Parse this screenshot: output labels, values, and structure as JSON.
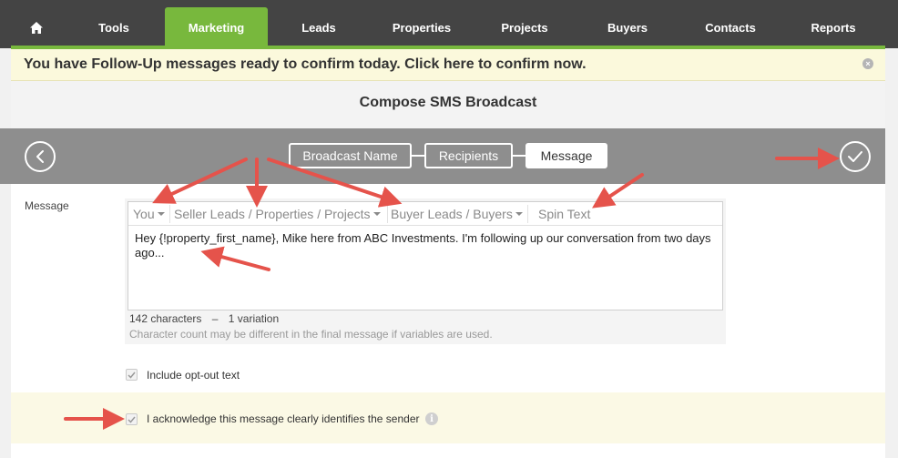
{
  "nav": {
    "home_icon": "home-icon",
    "items": [
      {
        "label": "Tools"
      },
      {
        "label": "Marketing"
      },
      {
        "label": "Leads"
      },
      {
        "label": "Properties"
      },
      {
        "label": "Projects"
      },
      {
        "label": "Buyers"
      },
      {
        "label": "Contacts"
      },
      {
        "label": "Reports"
      }
    ],
    "active": "Marketing"
  },
  "notice": {
    "text": "You have Follow-Up messages ready to confirm today. Click here to confirm now.",
    "close_symbol": "×"
  },
  "page": {
    "title": "Compose SMS Broadcast"
  },
  "wizard": {
    "steps": [
      {
        "label": "Broadcast Name"
      },
      {
        "label": "Recipients"
      },
      {
        "label": "Message"
      }
    ],
    "current": "Message",
    "back_icon": "chevron-left-icon",
    "confirm_icon": "checkmark-icon"
  },
  "message": {
    "label": "Message",
    "toolbar": {
      "you": "You",
      "seller": "Seller Leads / Properties / Projects",
      "buyer": "Buyer Leads / Buyers",
      "spin": "Spin Text"
    },
    "text": "Hey {!property_first_name}, Mike here from ABC Investments. I'm following up our conversation from two days ago...",
    "char_count": "142 characters",
    "count_separator": "–",
    "variations": "1 variation",
    "note": "Character count may be different in the final message if variables are used."
  },
  "optout": {
    "label": "Include opt-out text",
    "checked": true
  },
  "acknowledge": {
    "label": "I acknowledge this message clearly identifies the sender",
    "checked": true,
    "info_symbol": "i"
  },
  "colors": {
    "nav_bg": "#444444",
    "accent_green": "#78b83d",
    "wizard_bg": "#8e8e8e",
    "notice_bg": "#fbf9dc",
    "annotation_red": "#e5534b"
  }
}
